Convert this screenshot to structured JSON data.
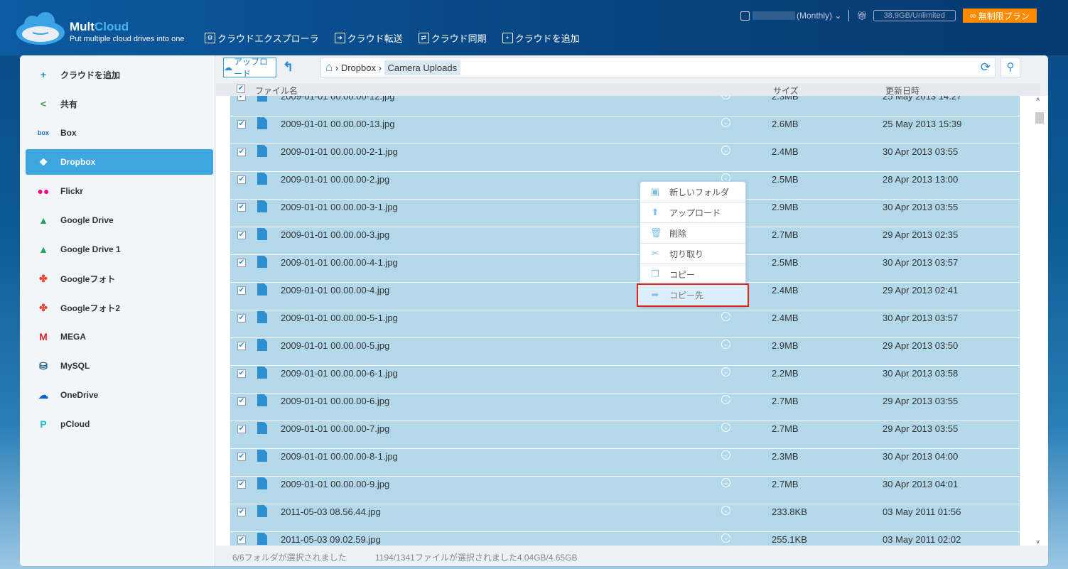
{
  "header": {
    "brand_a": "Mult",
    "brand_b": "Cloud",
    "tagline": "Put multiple cloud drives into one",
    "nav": [
      "クラウドエクスプローラ",
      "クラウド転送",
      "クラウド同期",
      "クラウドを追加"
    ],
    "plan": "(Monthly)",
    "quota": "38.9GB/Unlimited",
    "upgrade": "無制限プラン"
  },
  "sidebar": [
    {
      "label": "クラウドを追加",
      "icon": "add-cloud-icon",
      "color": "#2a8ad0",
      "glyph": "+"
    },
    {
      "label": "共有",
      "icon": "share-icon",
      "color": "#3aa845",
      "glyph": "<"
    },
    {
      "label": "Box",
      "icon": "box-icon",
      "color": "#1c6fb8",
      "glyph": "box"
    },
    {
      "label": "Dropbox",
      "icon": "dropbox-icon",
      "color": "#ffffff",
      "glyph": "❖",
      "active": true
    },
    {
      "label": "Flickr",
      "icon": "flickr-icon",
      "color": "#ff0084",
      "glyph": "●●"
    },
    {
      "label": "Google Drive",
      "icon": "google-drive-icon",
      "color": "#1fa463",
      "glyph": "▲"
    },
    {
      "label": "Google Drive 1",
      "icon": "google-drive-icon",
      "color": "#1fa463",
      "glyph": "▲"
    },
    {
      "label": "Googleフォト",
      "icon": "google-photos-icon",
      "color": "#ea4335",
      "glyph": "✤"
    },
    {
      "label": "Googleフォト2",
      "icon": "google-photos-icon",
      "color": "#ea4335",
      "glyph": "✤"
    },
    {
      "label": "MEGA",
      "icon": "mega-icon",
      "color": "#d9272e",
      "glyph": "M"
    },
    {
      "label": "MySQL",
      "icon": "mysql-icon",
      "color": "#1c5b8a",
      "glyph": "⛁"
    },
    {
      "label": "OneDrive",
      "icon": "onedrive-icon",
      "color": "#0a64c8",
      "glyph": "☁"
    },
    {
      "label": "pCloud",
      "icon": "pcloud-icon",
      "color": "#17bed0",
      "glyph": "P"
    }
  ],
  "toolbar": {
    "upload": "アップロード",
    "home": "⌂",
    "crumbs": [
      "Dropbox",
      "Camera Uploads"
    ]
  },
  "columns": {
    "name": "ファイル名",
    "size": "サイズ",
    "date": "更新日時"
  },
  "files": [
    [
      "2009-01-01 00.00.00-12.jpg",
      "2.3MB",
      "25 May 2013 14:27"
    ],
    [
      "2009-01-01 00.00.00-13.jpg",
      "2.6MB",
      "25 May 2013 15:39"
    ],
    [
      "2009-01-01 00.00.00-2-1.jpg",
      "2.4MB",
      "30 Apr 2013 03:55"
    ],
    [
      "2009-01-01 00.00.00-2.jpg",
      "2.5MB",
      "28 Apr 2013 13:00"
    ],
    [
      "2009-01-01 00.00.00-3-1.jpg",
      "2.9MB",
      "30 Apr 2013 03:55"
    ],
    [
      "2009-01-01 00.00.00-3.jpg",
      "2.7MB",
      "29 Apr 2013 02:35"
    ],
    [
      "2009-01-01 00.00.00-4-1.jpg",
      "2.5MB",
      "30 Apr 2013 03:57"
    ],
    [
      "2009-01-01 00.00.00-4.jpg",
      "2.4MB",
      "29 Apr 2013 02:41"
    ],
    [
      "2009-01-01 00.00.00-5-1.jpg",
      "2.4MB",
      "30 Apr 2013 03:57"
    ],
    [
      "2009-01-01 00.00.00-5.jpg",
      "2.9MB",
      "29 Apr 2013 03:50"
    ],
    [
      "2009-01-01 00.00.00-6-1.jpg",
      "2.2MB",
      "30 Apr 2013 03:58"
    ],
    [
      "2009-01-01 00.00.00-6.jpg",
      "2.7MB",
      "29 Apr 2013 03:55"
    ],
    [
      "2009-01-01 00.00.00-7.jpg",
      "2.7MB",
      "29 Apr 2013 03:55"
    ],
    [
      "2009-01-01 00.00.00-8-1.jpg",
      "2.3MB",
      "30 Apr 2013 04:00"
    ],
    [
      "2009-01-01 00.00.00-9.jpg",
      "2.7MB",
      "30 Apr 2013 04:01"
    ],
    [
      "2011-05-03 08.56.44.jpg",
      "233.8KB",
      "03 May 2011 01:56"
    ],
    [
      "2011-05-03 09.02.59.jpg",
      "255.1KB",
      "03 May 2011 02:02"
    ]
  ],
  "menu": [
    {
      "label": "新しいフォルダ",
      "icon": "new-folder-icon",
      "glyph": "▣"
    },
    {
      "label": "アップロード",
      "icon": "upload-icon",
      "glyph": "⬆"
    },
    {
      "label": "削除",
      "icon": "trash-icon",
      "glyph": "🗑"
    },
    {
      "label": "切り取り",
      "icon": "scissors-icon",
      "glyph": "✂"
    },
    {
      "label": "コピー",
      "icon": "copy-icon",
      "glyph": "❐"
    },
    {
      "label": "コピー先",
      "icon": "copy-to-icon",
      "glyph": "➦",
      "highlight": true
    }
  ],
  "footer": {
    "folders": "6/6フォルダが選択されました",
    "files": "1194/1341ファイルが選択されました4.04GB/4.65GB"
  }
}
